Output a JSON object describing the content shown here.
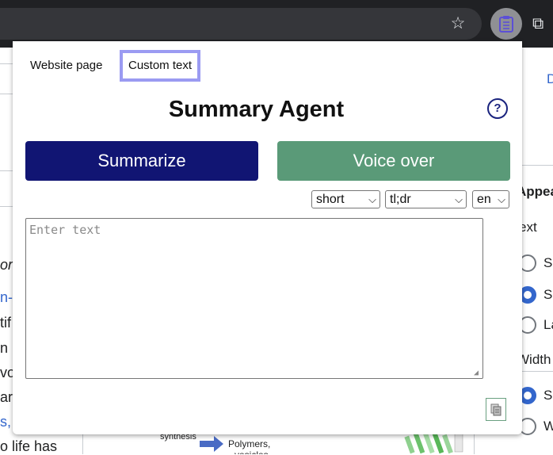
{
  "background_page": {
    "text_lines": [
      "or",
      "n-l",
      "tif",
      "n",
      "vo",
      "ar",
      "s,",
      "o life has"
    ],
    "right_panel": {
      "heading": "Appea",
      "section_text": "ext",
      "text_options": [
        "S",
        "S",
        "La"
      ],
      "width_label": "Width",
      "width_options": [
        "S",
        "W"
      ],
      "corner_link": "D"
    },
    "figure_labels": [
      "synthesis",
      "Polymers,",
      "vesicles"
    ]
  },
  "popup": {
    "tabs": [
      {
        "label": "Website page",
        "active": false
      },
      {
        "label": "Custom text",
        "active": true
      }
    ],
    "title": "Summary Agent",
    "help_label": "?",
    "summarize_label": "Summarize",
    "voice_over_label": "Voice over",
    "length_select": "short",
    "mode_select": "tl;dr",
    "language_select": "en",
    "text_input": {
      "value": "",
      "placeholder": "Enter text"
    }
  },
  "icons": [
    "star-icon",
    "clipboard-extension-icon",
    "puzzle-icon",
    "help-icon",
    "copy-icon"
  ],
  "colors": {
    "summarize_button": "#111573",
    "voice_over_button": "#5a9a78",
    "active_tab_border": "#9b9bf2",
    "browser_toolbar": "#202124"
  }
}
